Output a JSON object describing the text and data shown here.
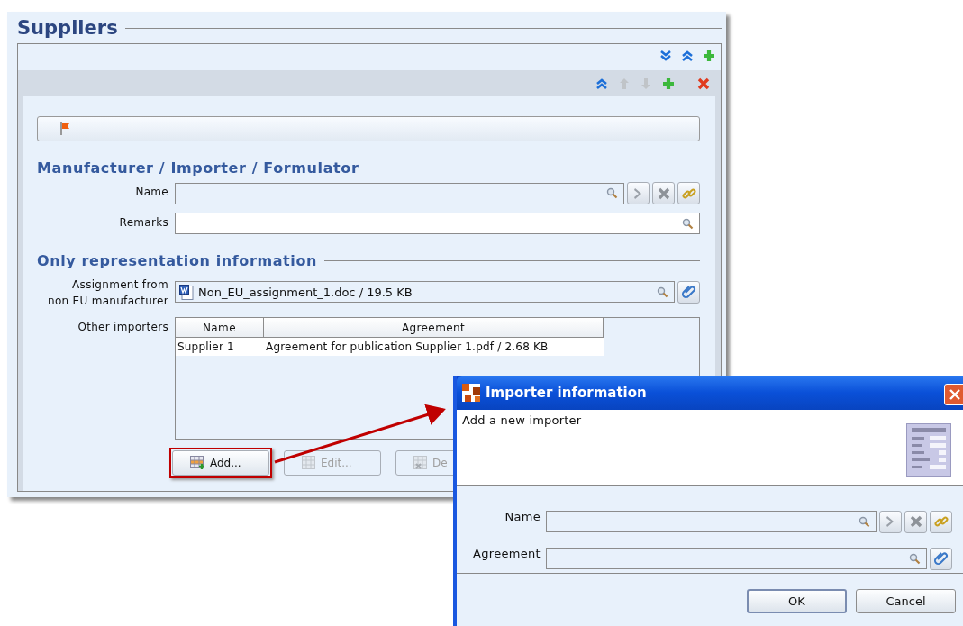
{
  "window": {
    "title": "Suppliers"
  },
  "sections": [
    {
      "title": "Manufacturer / Importer / Formulator",
      "fields": [
        {
          "label": [
            "Name"
          ],
          "kind": "lookup"
        },
        {
          "label": [
            "Remarks"
          ],
          "kind": "text"
        }
      ]
    },
    {
      "title": "Only representation information",
      "fields": [
        {
          "label": [
            "Assignment from",
            "non EU manufacturer"
          ],
          "kind": "file",
          "value": "Non_EU_assignment_1.doc / 19.5 KB"
        },
        {
          "label": [
            "Other importers"
          ],
          "kind": "table",
          "columns": [
            "Name",
            "Agreement"
          ],
          "rows": [
            [
              "Supplier 1",
              "Agreement for publication Supplier 1.pdf / 2.68 KB"
            ]
          ],
          "buttons": [
            {
              "label": "Add...",
              "kind": "add",
              "disabled": false,
              "highlighted": true
            },
            {
              "label": "Edit...",
              "kind": "edit",
              "disabled": true,
              "highlighted": false
            },
            {
              "label": "De",
              "kind": "delete",
              "disabled": true,
              "highlighted": false
            }
          ]
        }
      ]
    }
  ],
  "dialog": {
    "title": "Importer information",
    "description": "Add a new importer",
    "fields": [
      {
        "label": "Name",
        "kind": "lookup"
      },
      {
        "label": "Agreement",
        "kind": "file"
      }
    ],
    "buttons": [
      {
        "label": "OK",
        "default": true
      },
      {
        "label": "Cancel",
        "default": false
      }
    ]
  }
}
